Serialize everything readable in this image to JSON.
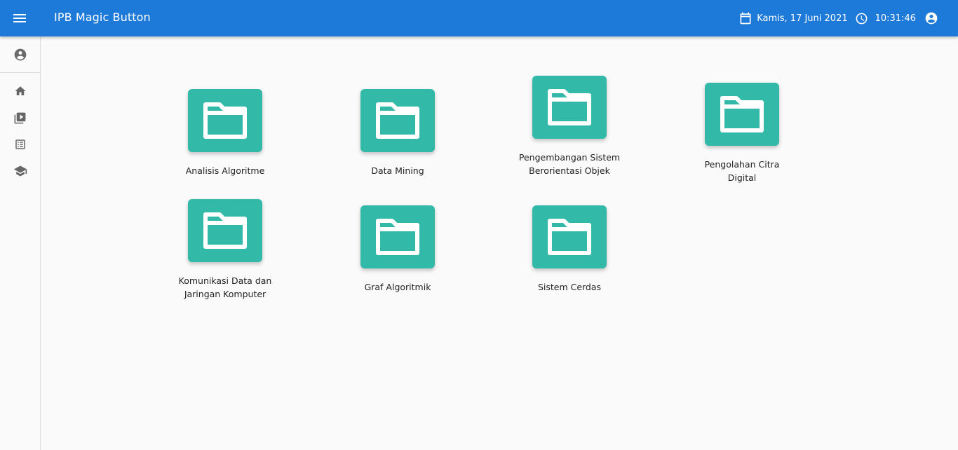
{
  "header": {
    "app_title": "IPB Magic Button",
    "date": "Kamis, 17 Juni 2021",
    "time": "10:31:46",
    "color": "#1e7ad8"
  },
  "sidebar": {
    "items": [
      {
        "icon": "home-icon"
      },
      {
        "icon": "video-library-icon"
      },
      {
        "icon": "list-icon"
      },
      {
        "icon": "school-icon"
      }
    ]
  },
  "courses": {
    "folder_color": "#32b9a8",
    "items": [
      {
        "label": "Analisis Algoritme"
      },
      {
        "label": "Data Mining"
      },
      {
        "label": "Pengembangan Sistem Berorientasi Objek"
      },
      {
        "label": "Pengolahan Citra Digital"
      },
      {
        "label": "Komunikasi Data dan Jaringan Komputer"
      },
      {
        "label": "Graf Algoritmik"
      },
      {
        "label": "Sistem Cerdas"
      }
    ]
  }
}
